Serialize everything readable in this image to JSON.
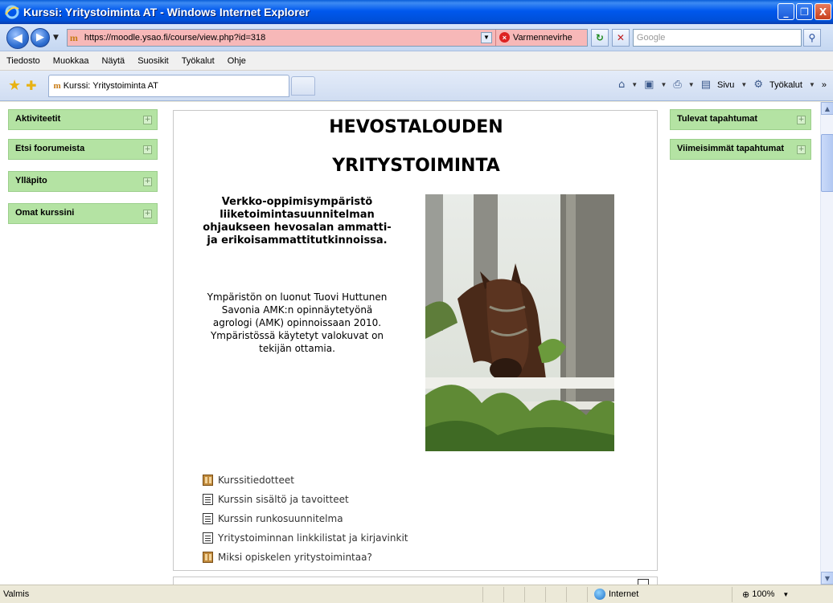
{
  "window": {
    "title": "Kurssi: Yritystoiminta AT - Windows Internet Explorer",
    "controls": {
      "minimize": "_",
      "maximize": "❐",
      "close": "X"
    }
  },
  "addressbar": {
    "url": "https://moodle.ysao.fi/course/view.php?id=318",
    "cert_error": "Varmennevirhe",
    "search_placeholder": "Google"
  },
  "menu": [
    "Tiedosto",
    "Muokkaa",
    "Näytä",
    "Suosikit",
    "Työkalut",
    "Ohje"
  ],
  "tab": {
    "label": "Kurssi: Yritystoiminta AT"
  },
  "commandbar": {
    "page_label": "Sivu",
    "tools_label": "Työkalut"
  },
  "left_blocks": [
    "Aktiviteetit",
    "Etsi foorumeista",
    "Ylläpito",
    "Omat kurssini"
  ],
  "right_blocks": [
    "Tulevat tapahtumat",
    "Viimeisimmät tapahtumat"
  ],
  "main": {
    "heading_line1": "HEVOSTALOUDEN",
    "heading_line2": "YRITYSTOIMINTA",
    "intro": "Verkko-oppimisympäristö liiketoimintasuunnitelman ohjaukseen  hevosalan ammatti- ja erikoisammattitutkinnoissa.",
    "credits": "Ympäristön on luonut Tuovi Huttunen Savonia AMK:n opinnäytetyönä agrologi (AMK) opinnoissaan 2010. Ympäristössä käytetyt valokuvat on tekijän ottamia.",
    "resources": [
      {
        "label": "Kurssitiedotteet",
        "icon": "forum-icon"
      },
      {
        "label": "Kurssin sisältö ja tavoitteet",
        "icon": "document-icon"
      },
      {
        "label": "Kurssin runkosuunnitelma",
        "icon": "document-icon"
      },
      {
        "label": "Yritystoiminnan linkkilistat ja kirjavinkit",
        "icon": "document-icon"
      },
      {
        "label": "Miksi opiskelen yritystoimintaa?",
        "icon": "forum-icon"
      }
    ]
  },
  "statusbar": {
    "status": "Valmis",
    "zone": "Internet",
    "zoom": "100%"
  },
  "colors": {
    "block_green": "#b4e3a3",
    "url_error_bg": "#f7b8b8",
    "titlebar_blue": "#0058ee"
  }
}
